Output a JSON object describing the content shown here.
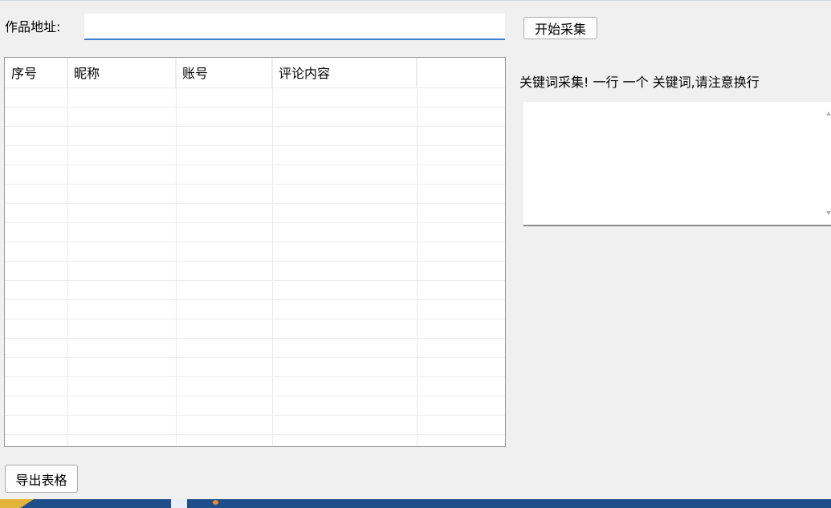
{
  "form": {
    "url_label": "作品地址:",
    "url_value": "",
    "start_button": "开始采集"
  },
  "table": {
    "columns": [
      "序号",
      "昵称",
      "账号",
      "评论内容",
      ""
    ],
    "rows": []
  },
  "keywords": {
    "label": "关键词采集! 一行 一个 关键词,请注意换行",
    "value": ""
  },
  "footer": {
    "export_button": "导出表格"
  },
  "colors": {
    "input_focus_border": "#3c7fd0",
    "window_background": "#f0f0f0",
    "taskbar": "#1f4f8a"
  }
}
